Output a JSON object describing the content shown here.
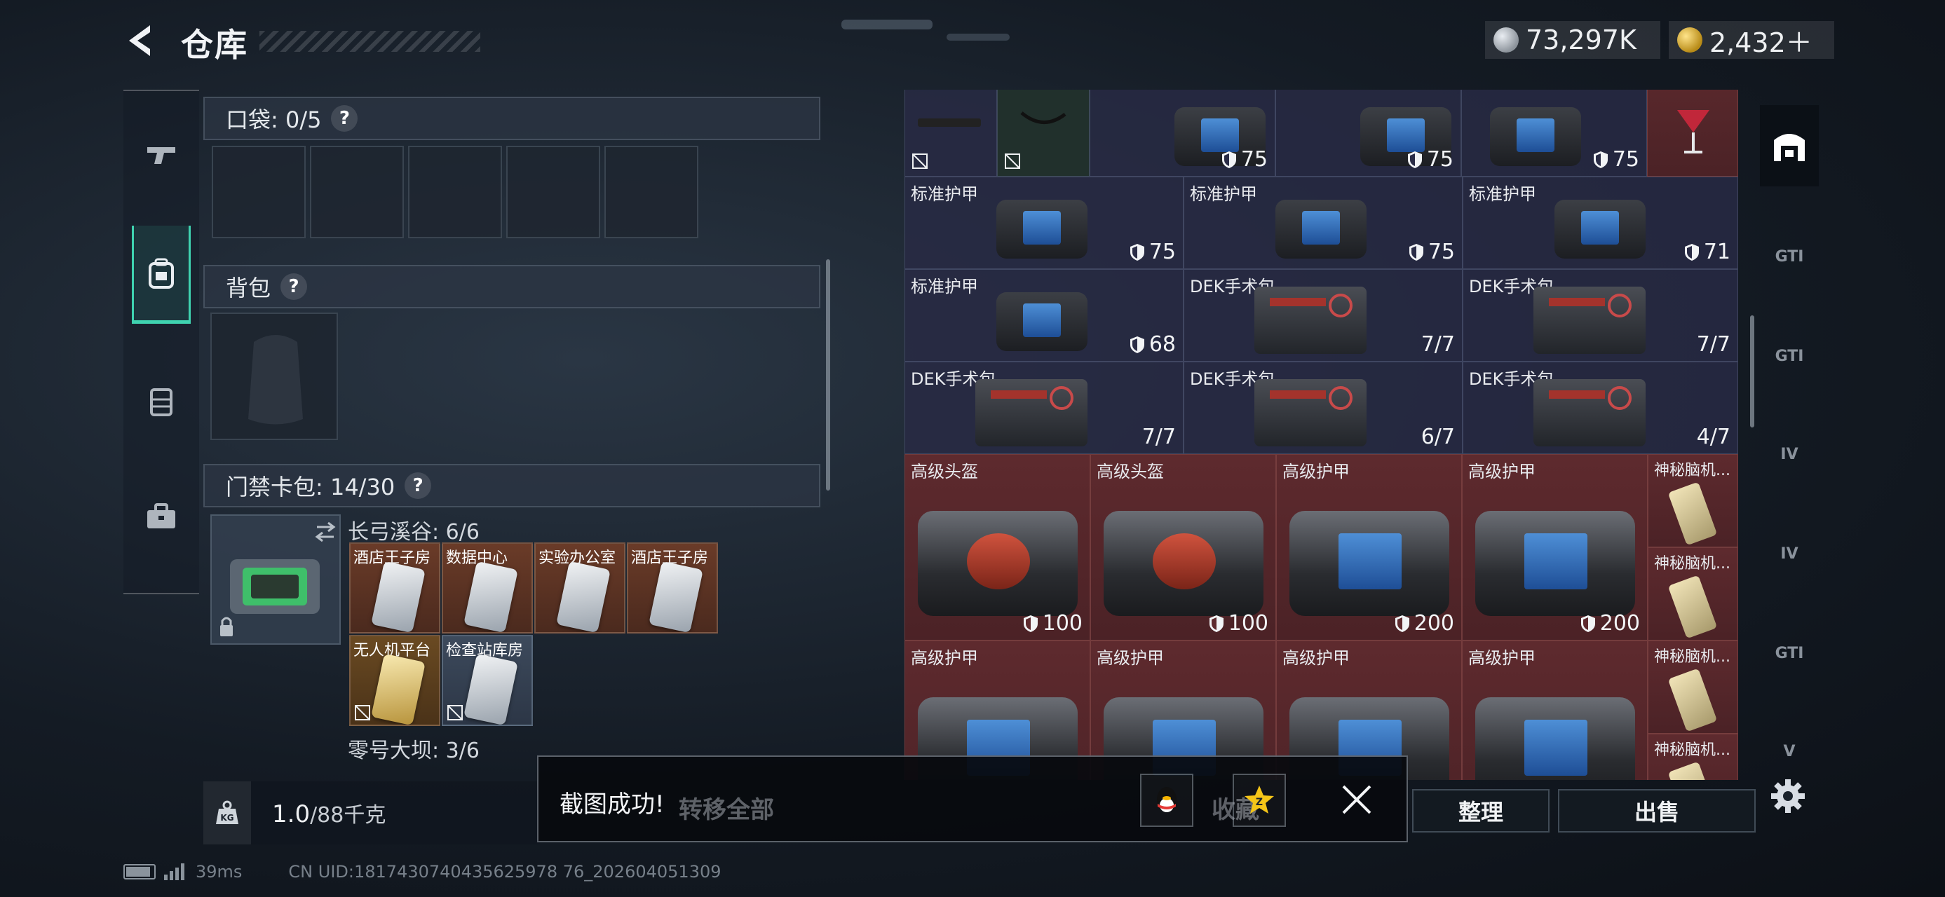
{
  "header": {
    "title": "仓库",
    "currency_silver": "73,297K",
    "currency_gold": "2,432＋"
  },
  "left_nav": {
    "items": [
      "gun-icon",
      "backpack-icon",
      "vest-icon",
      "toolbox-icon"
    ],
    "active": "backpack-icon"
  },
  "pockets": {
    "label": "口袋: 0/5",
    "slots": 5
  },
  "backpack": {
    "label": "背包"
  },
  "keycard_case": {
    "label": "门禁卡包: 14/30",
    "groups": [
      {
        "name": "长弓溪谷: 6/6",
        "cards": [
          {
            "label": "酒店王子房",
            "style": "red"
          },
          {
            "label": "数据中心",
            "style": "red"
          },
          {
            "label": "实验办公室",
            "style": "red"
          },
          {
            "label": "酒店王子房",
            "style": "red"
          },
          {
            "label": "无人机平台",
            "style": "gold"
          },
          {
            "label": "检查站库房",
            "style": "blue"
          }
        ]
      },
      {
        "name": "零号大坝: 3/6",
        "cards": []
      }
    ]
  },
  "weight": {
    "current": "1.0",
    "max": "/88千克"
  },
  "grid": {
    "row0": [
      {
        "name": "",
        "value": "",
        "style": "dark"
      },
      {
        "name": "",
        "value": "",
        "style": "green"
      },
      {
        "name": "",
        "value": "75",
        "style": "dark"
      },
      {
        "name": "",
        "value": "75",
        "style": "dark"
      },
      {
        "name": "",
        "value": "",
        "style": "red"
      }
    ],
    "row1": [
      {
        "name": "标准护甲",
        "value": "75"
      },
      {
        "name": "标准护甲",
        "value": "75"
      },
      {
        "name": "标准护甲",
        "value": "71"
      }
    ],
    "row2": [
      {
        "name": "标准护甲",
        "value": "68"
      },
      {
        "name": "DEK手术包",
        "value": "7/7"
      },
      {
        "name": "DEK手术包",
        "value": "7/7"
      }
    ],
    "row3": [
      {
        "name": "DEK手术包",
        "value": "7/7"
      },
      {
        "name": "DEK手术包",
        "value": "6/7"
      },
      {
        "name": "DEK手术包",
        "value": "4/7"
      }
    ],
    "row4": [
      {
        "name": "高级头盔",
        "value": "100"
      },
      {
        "name": "高级头盔",
        "value": "100"
      },
      {
        "name": "高级护甲",
        "value": "200"
      },
      {
        "name": "高级护甲",
        "value": "200"
      }
    ],
    "row5": [
      {
        "name": "高级护甲",
        "value": ""
      },
      {
        "name": "高级护甲",
        "value": ""
      },
      {
        "name": "高级护甲",
        "value": ""
      },
      {
        "name": "高级护甲",
        "value": ""
      }
    ],
    "mystery": [
      "神秘脑机...",
      "神秘脑机...",
      "神秘脑机...",
      "神秘脑机..."
    ]
  },
  "right_nav": {
    "items": [
      "GTI",
      "GTI",
      "IV",
      "IV",
      "GTI",
      "V"
    ]
  },
  "actions": {
    "sort": "整理",
    "sell": "出售",
    "transfer_all": "转移全部",
    "collect": "收藏"
  },
  "toast": {
    "message": "截图成功!"
  },
  "status": {
    "ping": "39ms",
    "uid": "CN UID:1817430740435625978 76_202604051309"
  },
  "colors": {
    "accent": "#3fd3b0",
    "red_cell": "#5e2a2e",
    "gold": "#d8b443"
  }
}
